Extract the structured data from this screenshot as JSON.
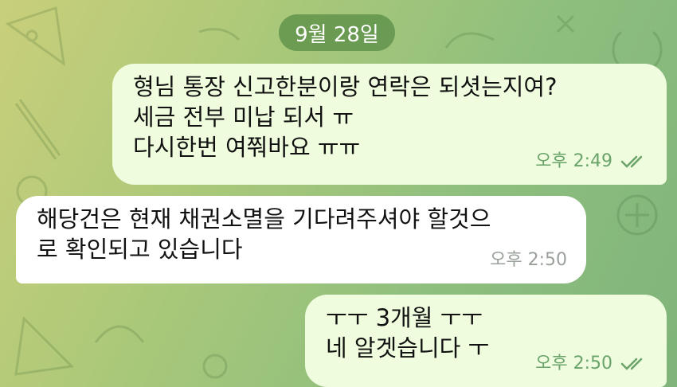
{
  "date_separator": "9월 28일",
  "messages": [
    {
      "direction": "outgoing",
      "lines": [
        "형님 통장 신고한분이랑 연락은 되셧는지여?",
        "세금 전부 미납 되서 ㅠ",
        "다시한번 여쭤바요 ㅠㅠ"
      ],
      "time": "오후 2:49",
      "status": "read"
    },
    {
      "direction": "incoming",
      "lines": [
        "해당건은 현재 채권소멸을 기다려주셔야 할것으",
        "로 확인되고 있습니다"
      ],
      "time": "오후 2:50"
    },
    {
      "direction": "outgoing",
      "lines": [
        "ㅜㅜ 3개월 ㅜㅜ",
        "네 알겟습니다 ㅜ"
      ],
      "time": "오후 2:50",
      "status": "read"
    }
  ],
  "colors": {
    "outgoing_bubble": "#effdde",
    "incoming_bubble": "#ffffff",
    "accent": "#6aa46a"
  }
}
